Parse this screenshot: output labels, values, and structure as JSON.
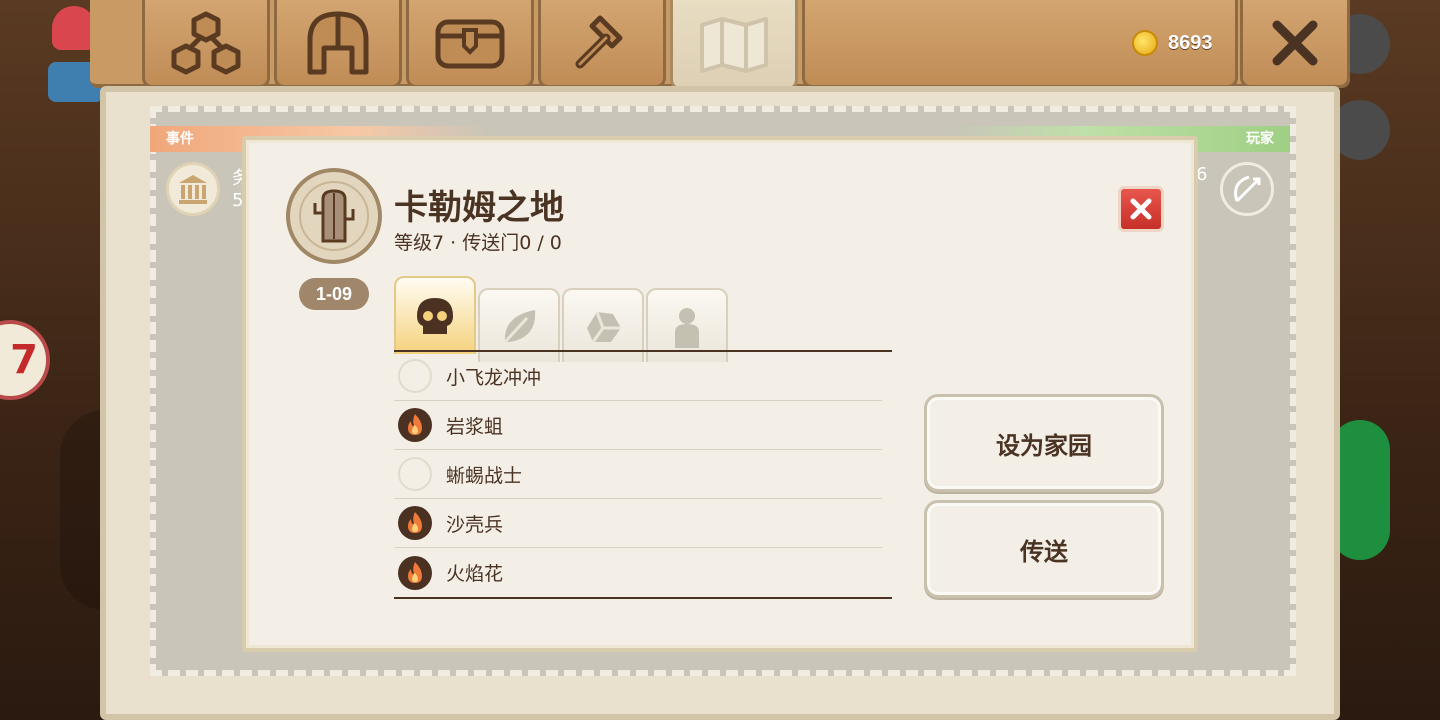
{
  "top_bar": {
    "tabs": [
      {
        "icon": "hexagons-icon"
      },
      {
        "icon": "helmet-icon"
      },
      {
        "icon": "treasure-chest-icon"
      },
      {
        "icon": "hammer-icon"
      },
      {
        "icon": "map-icon"
      }
    ],
    "coins": {
      "icon": "gold-coin-icon",
      "value": "8693"
    }
  },
  "board": {
    "left_ribbon": "事件",
    "right_ribbon": "玩家",
    "left_peek_text": "务",
    "left_peek_number": "5",
    "right_peek_number": "6"
  },
  "popup": {
    "location_name": "卡勒姆之地",
    "subtitle": "等级7 · 传送门0 / 0",
    "level_range": "1-09",
    "tabs": [
      {
        "icon": "skull-icon"
      },
      {
        "icon": "leaf-icon"
      },
      {
        "icon": "ore-icon"
      },
      {
        "icon": "person-icon"
      }
    ],
    "list": [
      {
        "label": "小飞龙冲冲",
        "icon": "empty-circle"
      },
      {
        "label": "岩浆蛆",
        "icon": "fire-icon"
      },
      {
        "label": "蜥蜴战士",
        "icon": "empty-circle"
      },
      {
        "label": "沙壳兵",
        "icon": "fire-icon"
      },
      {
        "label": "火焰花",
        "icon": "fire-icon"
      }
    ],
    "buttons": {
      "set_home": "设为家园",
      "teleport": "传送"
    }
  },
  "colors": {
    "wood": "#c99a64",
    "parchment": "#f3efe6",
    "text_brown": "#4b3324",
    "close_red": "#d63b33",
    "ribbon_orange": "#f0a77a",
    "ribbon_green": "#9fcf84"
  }
}
